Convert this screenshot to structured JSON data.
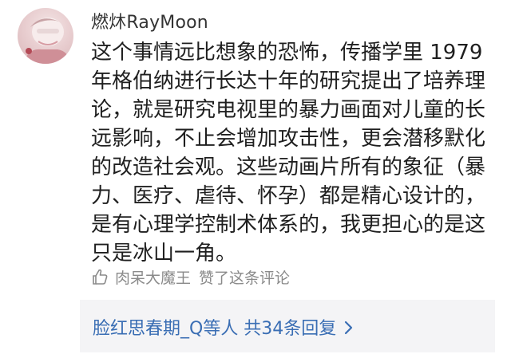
{
  "comment": {
    "username": "燃炑RayMoon",
    "lines": [
      "这个事情远比想象的恐怖，传播学里 1979",
      "年格伯纳进行长达十年的研究提出了培养理",
      "论，就是研究电视里的暴力画面对儿童的长",
      "远影响，不止会增加攻击性，更会潜移默化",
      "的改造社会观。这些动画片所有的象征（暴",
      "力、医疗、虐待、怀孕）都是精心设计的，",
      "是有心理学控制术体系的，我更担心的是这",
      "只是冰山一角。"
    ],
    "like": {
      "icon": "thumbs-up-icon",
      "user": "肉呆大魔王",
      "action": "赞了这条评论"
    },
    "replies": {
      "label": "脸红思春期_Q等人 共34条回复",
      "icon": "chevron-right-icon"
    }
  },
  "colors": {
    "text": "#1f1f1f",
    "username": "#333333",
    "muted": "#8a8a8a",
    "link": "#3a6eb4",
    "reply_bg": "#f4f4f6"
  }
}
